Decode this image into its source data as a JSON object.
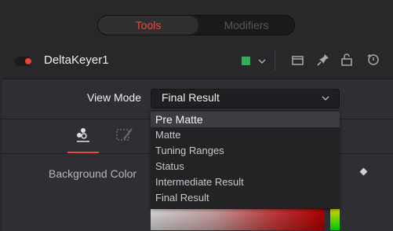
{
  "tabs": [
    {
      "label": "Tools",
      "active": true
    },
    {
      "label": "Modifiers",
      "active": false
    }
  ],
  "tool": {
    "name": "DeltaKeyer1",
    "enabled": true,
    "color_swatch": "#3aa860"
  },
  "header_icons": [
    "chevron-down-icon",
    "window-icon",
    "pin-icon",
    "lock-icon",
    "reset-icon"
  ],
  "view_mode": {
    "label": "View Mode",
    "value": "Final Result",
    "options": [
      "Pre Matte",
      "Matte",
      "Tuning Ranges",
      "Status",
      "Intermediate Result",
      "Final Result"
    ],
    "highlighted": "Pre Matte"
  },
  "subtabs": [
    "key-tab-icon",
    "pre-matte-tab-icon"
  ],
  "background_color": {
    "label": "Background Color"
  },
  "colors": {
    "accent": "#e64b3d",
    "panel": "#2f2f33",
    "dropdown_bg": "#232326"
  }
}
